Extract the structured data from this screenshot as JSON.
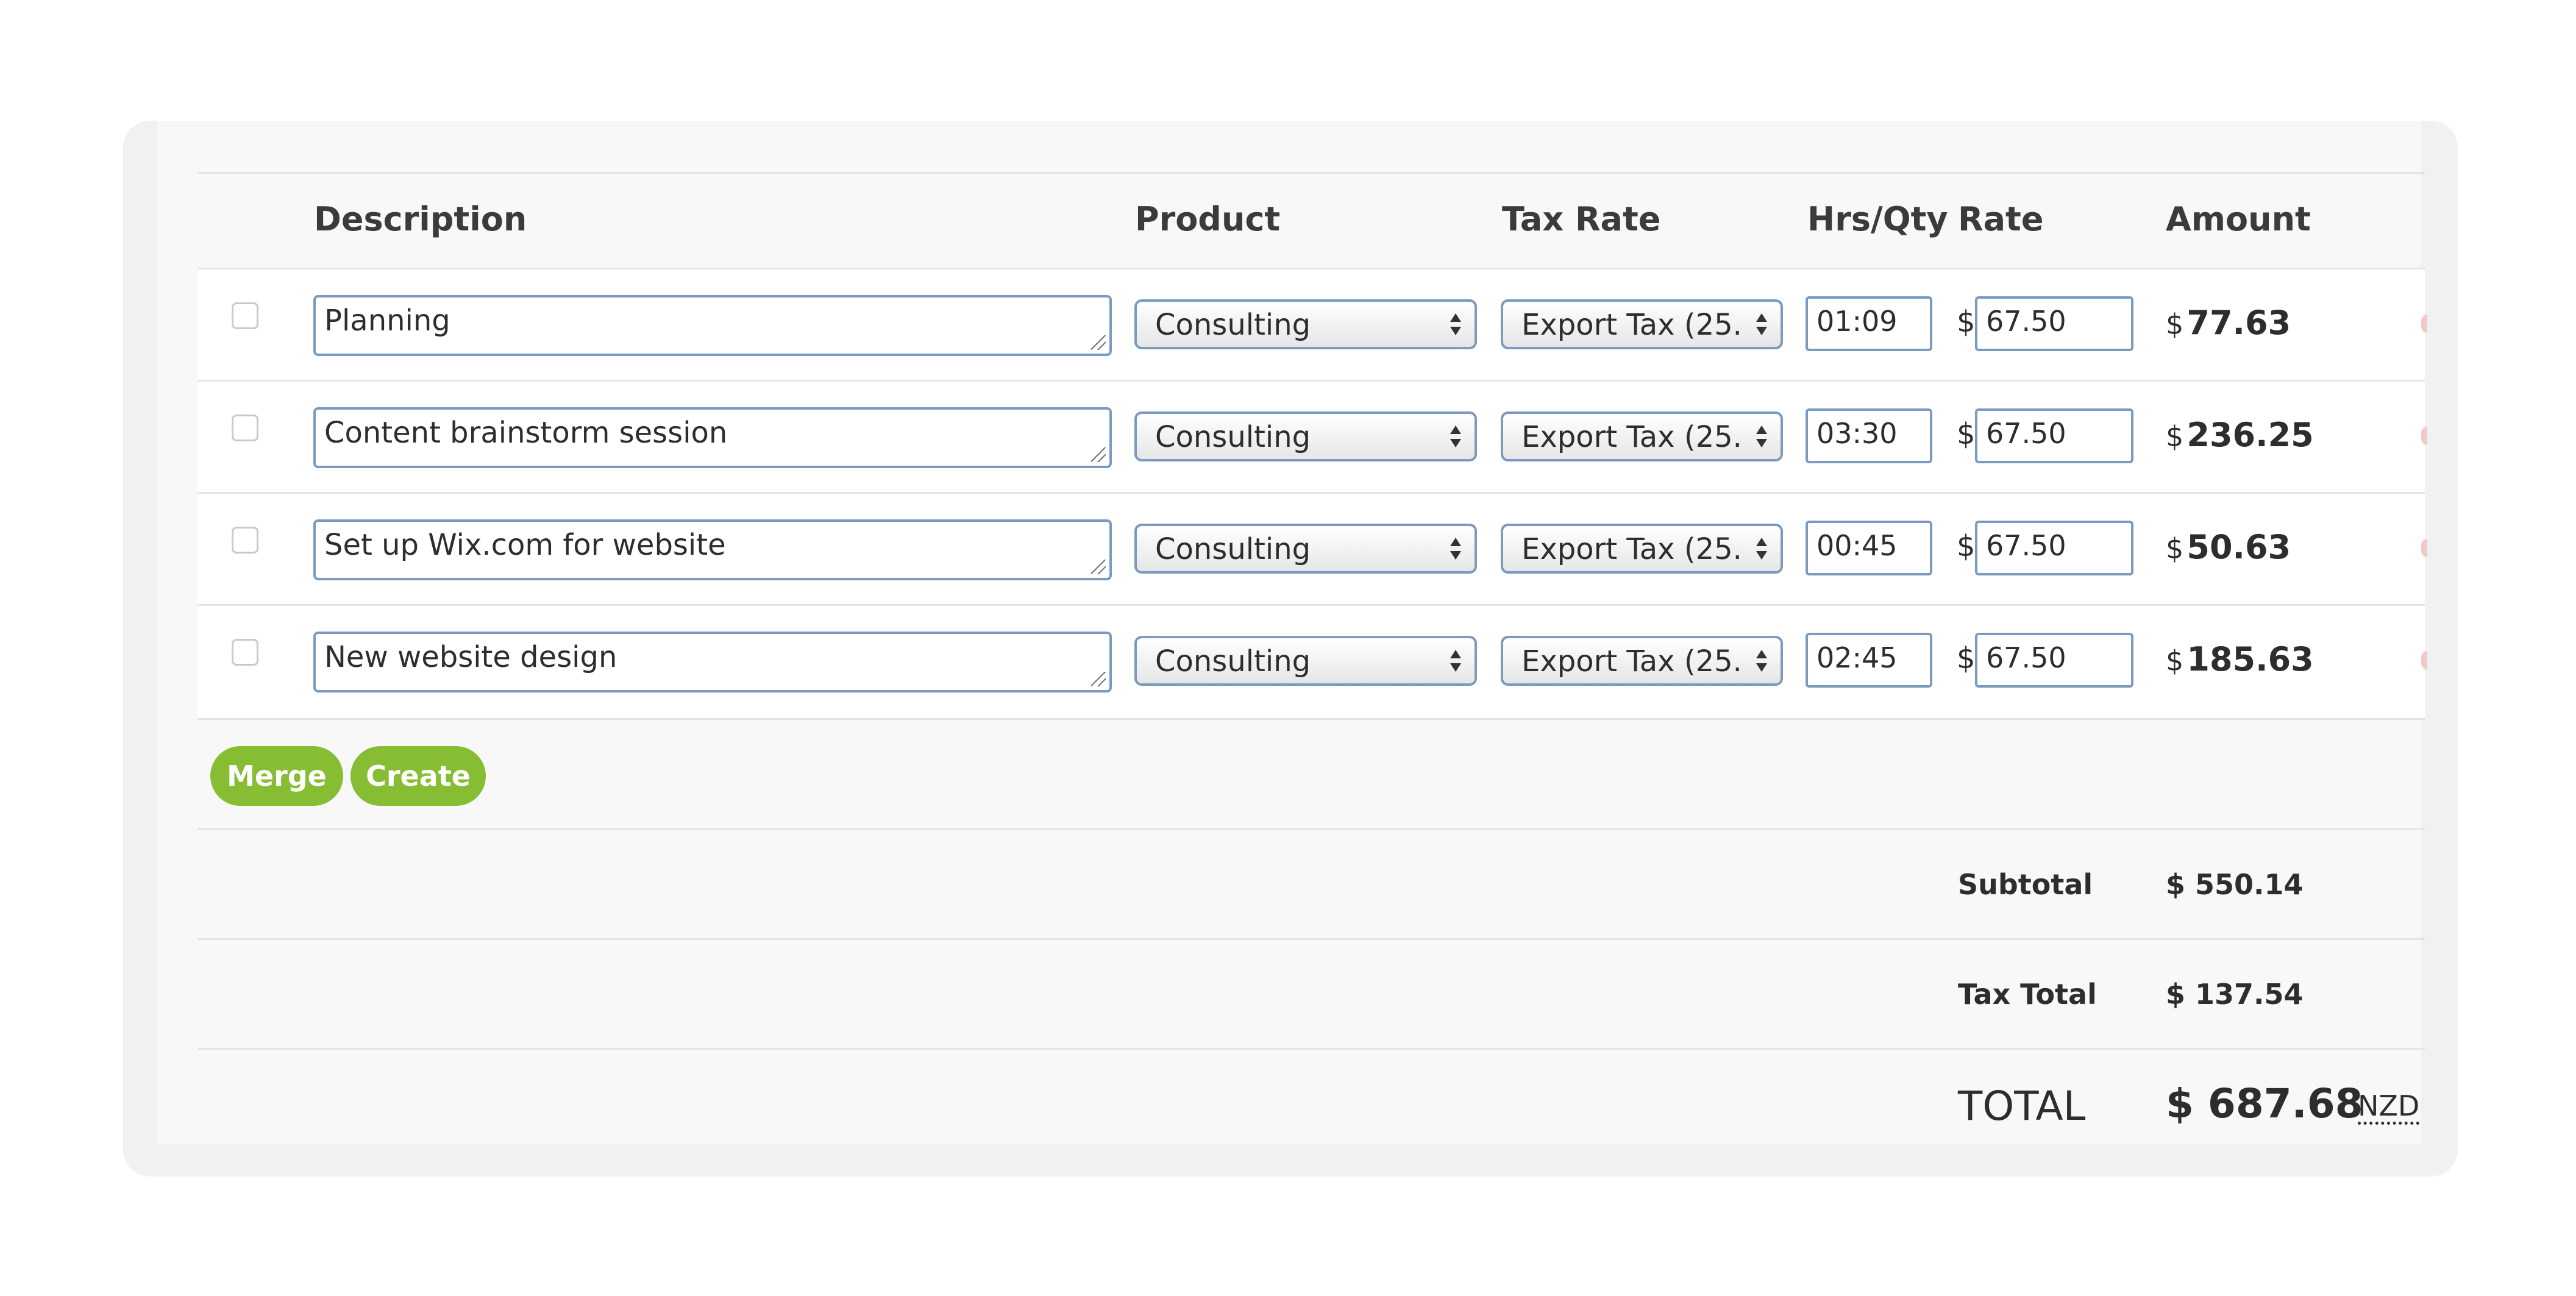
{
  "columns": {
    "description": "Description",
    "product": "Product",
    "tax_rate": "Tax Rate",
    "hrs_qty": "Hrs/Qty",
    "rate": "Rate",
    "amount": "Amount"
  },
  "currency_symbol": "$",
  "rows": [
    {
      "description": "Planning",
      "product": "Consulting",
      "tax_rate": "Export Tax (25.",
      "hrs_qty": "01:09",
      "rate": "67.50",
      "amount": "77.63"
    },
    {
      "description": "Content brainstorm session",
      "product": "Consulting",
      "tax_rate": "Export Tax (25.",
      "hrs_qty": "03:30",
      "rate": "67.50",
      "amount": "236.25"
    },
    {
      "description": "Set up Wix.com for website",
      "product": "Consulting",
      "tax_rate": "Export Tax (25.",
      "hrs_qty": "00:45",
      "rate": "67.50",
      "amount": "50.63"
    },
    {
      "description": "New website design",
      "product": "Consulting",
      "tax_rate": "Export Tax (25.",
      "hrs_qty": "02:45",
      "rate": "67.50",
      "amount": "185.63"
    }
  ],
  "actions": {
    "merge": "Merge",
    "create": "Create"
  },
  "summary": {
    "subtotal_label": "Subtotal",
    "subtotal_value": "$ 550.14",
    "tax_total_label": "Tax Total",
    "tax_total_value": "$ 137.54",
    "total_label": "TOTAL",
    "total_value": "$ 687.68",
    "currency_code": "NZD"
  },
  "colors": {
    "button_green": "#87bd32",
    "input_border": "#7a9bbf"
  }
}
